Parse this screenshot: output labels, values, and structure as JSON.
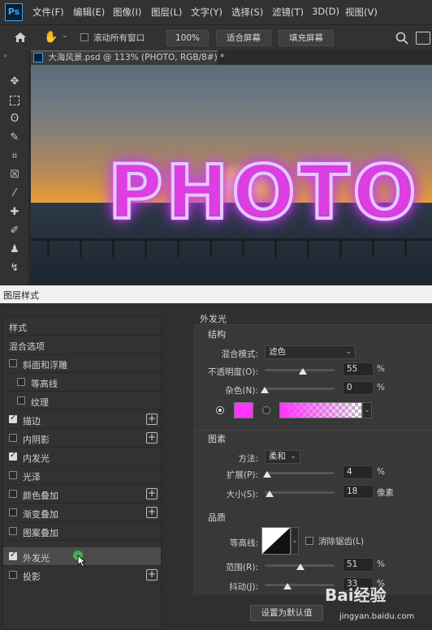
{
  "menubar": {
    "logo": "Ps",
    "items": [
      "文件(F)",
      "编辑(E)",
      "图像(I)",
      "图层(L)",
      "文字(Y)",
      "选择(S)",
      "滤镜(T)",
      "3D(D)",
      "视图(V)"
    ]
  },
  "options": {
    "scroll_all_label": "滚动所有窗口",
    "zoom_value": "100%",
    "fit_screen_label": "适合屏幕",
    "fill_screen_label": "填充屏幕"
  },
  "document": {
    "tab_title": "大海风景.psd @ 113% (PHOTO, RGB/8#) *",
    "canvas_text": "PHOTO"
  },
  "dialog": {
    "title": "图层样式",
    "left_items": [
      {
        "label": "样式",
        "checkbox": "none",
        "plus": false
      },
      {
        "label": "混合选项",
        "checkbox": "none",
        "plus": false
      },
      {
        "label": "斜面和浮雕",
        "checkbox": "off",
        "plus": false
      },
      {
        "label": "等高线",
        "checkbox": "off",
        "plus": false
      },
      {
        "label": "纹理",
        "checkbox": "off",
        "plus": false
      },
      {
        "label": "描边",
        "checkbox": "on",
        "plus": true
      },
      {
        "label": "内阴影",
        "checkbox": "off",
        "plus": true
      },
      {
        "label": "内发光",
        "checkbox": "on",
        "plus": false
      },
      {
        "label": "光泽",
        "checkbox": "off",
        "plus": false
      },
      {
        "label": "颜色叠加",
        "checkbox": "off",
        "plus": true
      },
      {
        "label": "渐变叠加",
        "checkbox": "off",
        "plus": true
      },
      {
        "label": "图案叠加",
        "checkbox": "off",
        "plus": false
      },
      {
        "label": "外发光",
        "checkbox": "on",
        "plus": false
      },
      {
        "label": "投影",
        "checkbox": "off",
        "plus": true
      }
    ],
    "panel_title": "外发光",
    "structure": {
      "title": "结构",
      "blend_mode_label": "混合模式:",
      "blend_mode_value": "滤色",
      "opacity_label": "不透明度(O):",
      "opacity_value": "55",
      "opacity_unit": "%",
      "opacity_fraction": 0.55,
      "noise_label": "杂色(N):",
      "noise_value": "0",
      "noise_unit": "%",
      "noise_fraction": 0.0,
      "glow_color": "#ff33ff"
    },
    "elements": {
      "title": "图素",
      "technique_label": "方法:",
      "technique_value": "柔和",
      "spread_label": "扩展(P):",
      "spread_value": "4",
      "spread_unit": "%",
      "spread_fraction": 0.04,
      "size_label": "大小(S):",
      "size_value": "18",
      "size_unit": "像素",
      "size_fraction": 0.072
    },
    "quality": {
      "title": "品质",
      "contour_label": "等高线:",
      "antialias_label": "消除锯齿(L)",
      "range_label": "范围(R):",
      "range_value": "51",
      "range_unit": "%",
      "range_fraction": 0.51,
      "jitter_label": "抖动(J):",
      "jitter_value": "33",
      "jitter_unit": "%",
      "jitter_fraction": 0.33
    },
    "default_button": "设置为默认值"
  },
  "watermark": {
    "text": "Bai经验",
    "url_text": "jingyan.baidu.com"
  }
}
